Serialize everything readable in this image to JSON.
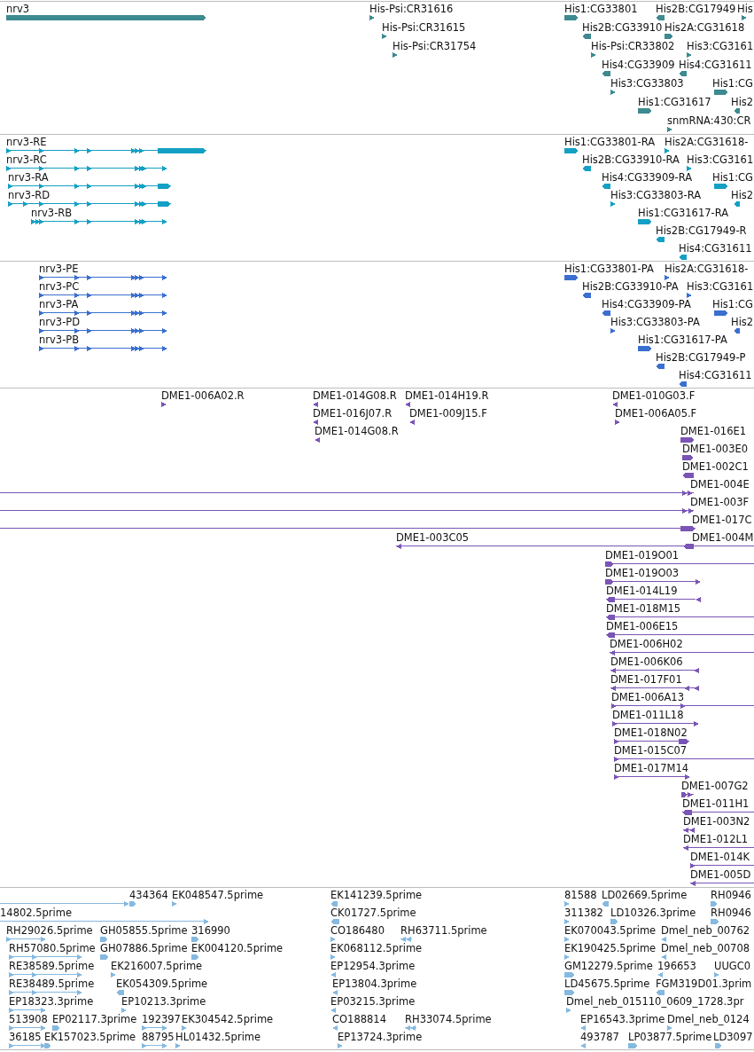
{
  "tracks": [
    {
      "color": "#3d8a90",
      "rows": [
        {
          "features": [
            {
              "label": "nrv3",
              "reverse": false
            },
            {
              "label": "His-Psi:CR31616",
              "reverse": false
            },
            {
              "label": "His1:CG33801",
              "reverse": false
            },
            {
              "label": "His2B:CG17949",
              "reverse": true
            },
            {
              "label": "His",
              "reverse": false
            }
          ]
        },
        {
          "features": [
            {
              "label": "His-Psi:CR31615",
              "reverse": false
            },
            {
              "label": "His2B:CG33910",
              "reverse": true
            },
            {
              "label": "His2A:CG31618",
              "reverse": false
            }
          ]
        },
        {
          "features": [
            {
              "label": "His-Psi:CR31754",
              "reverse": false
            },
            {
              "label": "His-Psi:CR33802",
              "reverse": false
            },
            {
              "label": "His3:CG3161",
              "reverse": false
            }
          ]
        },
        {
          "features": [
            {
              "label": "His4:CG33909",
              "reverse": true
            },
            {
              "label": "His4:CG31611",
              "reverse": true
            }
          ]
        },
        {
          "features": [
            {
              "label": "His3:CG33803",
              "reverse": false
            },
            {
              "label": "His1:CG",
              "reverse": false
            }
          ]
        },
        {
          "features": [
            {
              "label": "His1:CG31617",
              "reverse": false
            },
            {
              "label": "His2",
              "reverse": true
            }
          ]
        },
        {
          "features": [
            {
              "label": "snmRNA:430:CR",
              "reverse": false
            }
          ]
        }
      ]
    },
    {
      "color": "#14a0c4",
      "rows": [
        {
          "features": [
            {
              "label": "nrv3-RE",
              "reverse": false
            },
            {
              "label": "His1:CG33801-RA",
              "reverse": false
            },
            {
              "label": "His2A:CG31618-",
              "reverse": false
            }
          ]
        },
        {
          "features": [
            {
              "label": "nrv3-RC",
              "reverse": false
            },
            {
              "label": "His2B:CG33910-RA",
              "reverse": true
            },
            {
              "label": "His3:CG3161",
              "reverse": false
            }
          ]
        },
        {
          "features": [
            {
              "label": "nrv3-RA",
              "reverse": false
            },
            {
              "label": "His4:CG33909-RA",
              "reverse": true
            },
            {
              "label": "His1:CG",
              "reverse": false
            }
          ]
        },
        {
          "features": [
            {
              "label": "nrv3-RD",
              "reverse": false
            },
            {
              "label": "His3:CG33803-RA",
              "reverse": false
            },
            {
              "label": "His2",
              "reverse": true
            }
          ]
        },
        {
          "features": [
            {
              "label": "nrv3-RB",
              "reverse": false
            },
            {
              "label": "His1:CG31617-RA",
              "reverse": false
            }
          ]
        },
        {
          "features": [
            {
              "label": "His2B:CG17949-R",
              "reverse": true
            }
          ]
        },
        {
          "features": [
            {
              "label": "His4:CG31611",
              "reverse": true
            }
          ]
        }
      ]
    },
    {
      "color": "#3a6fd0",
      "rows": [
        {
          "features": [
            {
              "label": "nrv3-PE",
              "reverse": false
            },
            {
              "label": "His1:CG33801-PA",
              "reverse": false
            },
            {
              "label": "His2A:CG31618-",
              "reverse": false
            }
          ]
        },
        {
          "features": [
            {
              "label": "nrv3-PC",
              "reverse": false
            },
            {
              "label": "His2B:CG33910-PA",
              "reverse": true
            },
            {
              "label": "His3:CG3161",
              "reverse": false
            }
          ]
        },
        {
          "features": [
            {
              "label": "nrv3-PA",
              "reverse": false
            },
            {
              "label": "His4:CG33909-PA",
              "reverse": true
            },
            {
              "label": "His1:CG",
              "reverse": false
            }
          ]
        },
        {
          "features": [
            {
              "label": "nrv3-PD",
              "reverse": false
            },
            {
              "label": "His3:CG33803-PA",
              "reverse": false
            },
            {
              "label": "His2",
              "reverse": true
            }
          ]
        },
        {
          "features": [
            {
              "label": "nrv3-PB",
              "reverse": false
            },
            {
              "label": "His1:CG31617-PA",
              "reverse": false
            }
          ]
        },
        {
          "features": [
            {
              "label": "His2B:CG17949-P",
              "reverse": true
            }
          ]
        },
        {
          "features": [
            {
              "label": "His4:CG31611",
              "reverse": true
            }
          ]
        }
      ]
    },
    {
      "color": "#7a55b5",
      "rows": [
        {
          "features": [
            {
              "label": "DME1-006A02.R",
              "reverse": false
            },
            {
              "label": "DME1-014G08.R",
              "reverse": true
            },
            {
              "label": "DME1-014H19.R",
              "reverse": true
            },
            {
              "label": "DME1-010G03.F",
              "reverse": true
            }
          ]
        },
        {
          "features": [
            {
              "label": "DME1-016J07.R",
              "reverse": true
            },
            {
              "label": "DME1-009J15.F",
              "reverse": true
            },
            {
              "label": "DME1-006A05.F",
              "reverse": false
            }
          ]
        },
        {
          "features": [
            {
              "label": "DME1-014G08.R",
              "reverse": true
            },
            {
              "label": "DME1-016E1",
              "reverse": false
            }
          ]
        },
        {
          "features": [
            {
              "label": "DME1-003E0",
              "reverse": false
            }
          ]
        },
        {
          "features": [
            {
              "label": "DME1-002C1",
              "reverse": true
            }
          ]
        },
        {
          "features": [
            {
              "label": "DME1-004E",
              "reverse": false
            }
          ]
        },
        {
          "features": [
            {
              "label": "DME1-003F",
              "reverse": false
            }
          ]
        },
        {
          "features": [
            {
              "label": "DME1-017C",
              "reverse": false
            }
          ]
        },
        {
          "features": [
            {
              "label": "DME1-003C05",
              "reverse": true
            },
            {
              "label": "DME1-004M",
              "reverse": true
            }
          ]
        },
        {
          "features": [
            {
              "label": "DME1-019O01",
              "reverse": false
            }
          ]
        },
        {
          "features": [
            {
              "label": "DME1-019O03",
              "reverse": false
            }
          ]
        },
        {
          "features": [
            {
              "label": "DME1-014L19",
              "reverse": true
            }
          ]
        },
        {
          "features": [
            {
              "label": "DME1-018M15",
              "reverse": true
            }
          ]
        },
        {
          "features": [
            {
              "label": "DME1-006E15",
              "reverse": true
            }
          ]
        },
        {
          "features": [
            {
              "label": "DME1-006H02",
              "reverse": true
            }
          ]
        },
        {
          "features": [
            {
              "label": "DME1-006K06",
              "reverse": true
            }
          ]
        },
        {
          "features": [
            {
              "label": "DME1-017F01",
              "reverse": true
            }
          ]
        },
        {
          "features": [
            {
              "label": "DME1-006A13",
              "reverse": false
            }
          ]
        },
        {
          "features": [
            {
              "label": "DME1-011L18",
              "reverse": false
            }
          ]
        },
        {
          "features": [
            {
              "label": "DME1-018N02",
              "reverse": false
            }
          ]
        },
        {
          "features": [
            {
              "label": "DME1-015C07",
              "reverse": false
            }
          ]
        },
        {
          "features": [
            {
              "label": "DME1-017M14",
              "reverse": false
            }
          ]
        },
        {
          "features": [
            {
              "label": "DME1-007G2",
              "reverse": false
            }
          ]
        },
        {
          "features": [
            {
              "label": "DME1-011H1",
              "reverse": true
            }
          ]
        },
        {
          "features": [
            {
              "label": "DME1-003N2",
              "reverse": true
            }
          ]
        },
        {
          "features": [
            {
              "label": "DME1-012L1",
              "reverse": true
            }
          ]
        },
        {
          "features": [
            {
              "label": "DME1-014K",
              "reverse": false
            }
          ]
        },
        {
          "features": [
            {
              "label": "DME1-005D",
              "reverse": true
            }
          ]
        }
      ]
    },
    {
      "color": "#85b9e0",
      "rows": [
        {
          "features": [
            {
              "reverse": false
            },
            {
              "label": "434364",
              "reverse": false
            },
            {
              "label": "EK048547.5prime",
              "reverse": false
            },
            {
              "label": "EK141239.5prime",
              "reverse": true
            },
            {
              "label": "81588",
              "reverse": false
            },
            {
              "label": "LD02669.5prime",
              "reverse": true
            },
            {
              "label": "RH0946",
              "reverse": false
            }
          ]
        },
        {
          "features": [
            {
              "label": "14802.5prime",
              "reverse": false
            },
            {
              "label": "CK01727.5prime",
              "reverse": true
            },
            {
              "label": "311382",
              "reverse": false
            },
            {
              "label": "LD10326.3prime",
              "reverse": false
            },
            {
              "label": "RH0946",
              "reverse": false
            }
          ]
        },
        {
          "features": [
            {
              "label": "RH29026.5prime",
              "reverse": false
            },
            {
              "label": "GH05855.5prime",
              "reverse": false
            },
            {
              "label": "316990",
              "reverse": false
            },
            {
              "label": "CO186480",
              "reverse": false
            },
            {
              "label": "RH63711.5prime",
              "reverse": true
            },
            {
              "label": "EK070043.5prime",
              "reverse": false
            },
            {
              "label": "Dmel_neb_00762",
              "reverse": true
            }
          ]
        },
        {
          "features": [
            {
              "label": "RH57080.5prime",
              "reverse": false
            },
            {
              "label": "GH07886.5prime",
              "reverse": false
            },
            {
              "label": "EK004120.5prime",
              "reverse": false
            },
            {
              "label": "EK068112.5prime",
              "reverse": false
            },
            {
              "label": "EK190425.5prime",
              "reverse": false
            },
            {
              "label": "Dmel_neb_00708",
              "reverse": true
            }
          ]
        },
        {
          "features": [
            {
              "label": "RE38589.5prime",
              "reverse": false
            },
            {
              "label": "EK216007.5prime",
              "reverse": false
            },
            {
              "label": "EP12954.3prime",
              "reverse": true
            },
            {
              "label": "GM12279.5prime",
              "reverse": false
            },
            {
              "label": "196653",
              "reverse": true
            },
            {
              "label": "UUGC0",
              "reverse": false
            }
          ]
        },
        {
          "features": [
            {
              "label": "RE38489.5prime",
              "reverse": false
            },
            {
              "label": "EK054309.5prime",
              "reverse": true
            },
            {
              "label": "EP13804.3prime",
              "reverse": true
            },
            {
              "label": "LD45675.5prime",
              "reverse": false
            },
            {
              "label": "FGM319D01.3prim",
              "reverse": true
            }
          ]
        },
        {
          "features": [
            {
              "label": "EP18323.3prime",
              "reverse": false
            },
            {
              "label": "EP10213.3prime",
              "reverse": false
            },
            {
              "label": "EP03215.3prime",
              "reverse": true
            },
            {
              "label": "Dmel_neb_015110_0609_1728.3pr",
              "reverse": false
            }
          ]
        },
        {
          "features": [
            {
              "label": "513908",
              "reverse": false
            },
            {
              "label": "EP02117.3prime",
              "reverse": false
            },
            {
              "label": "192397",
              "reverse": false
            },
            {
              "label": "EK304542.5prime",
              "reverse": false
            },
            {
              "label": "CO188814",
              "reverse": true
            },
            {
              "label": "RH33074.5prime",
              "reverse": true
            },
            {
              "label": "EP16543.3prime",
              "reverse": true
            },
            {
              "label": "Dmel_neb_0124",
              "reverse": false
            }
          ]
        },
        {
          "features": [
            {
              "label": "36185",
              "reverse": false
            },
            {
              "label": "EK157023.5prime",
              "reverse": false
            },
            {
              "label": "88795",
              "reverse": false
            },
            {
              "label": "HL01432.5prime",
              "reverse": false
            },
            {
              "label": "EP13724.3prime",
              "reverse": false
            },
            {
              "label": "493787",
              "reverse": true
            },
            {
              "label": "LP03877.5prime",
              "reverse": false
            },
            {
              "label": "LD3097",
              "reverse": false
            }
          ]
        }
      ]
    }
  ]
}
